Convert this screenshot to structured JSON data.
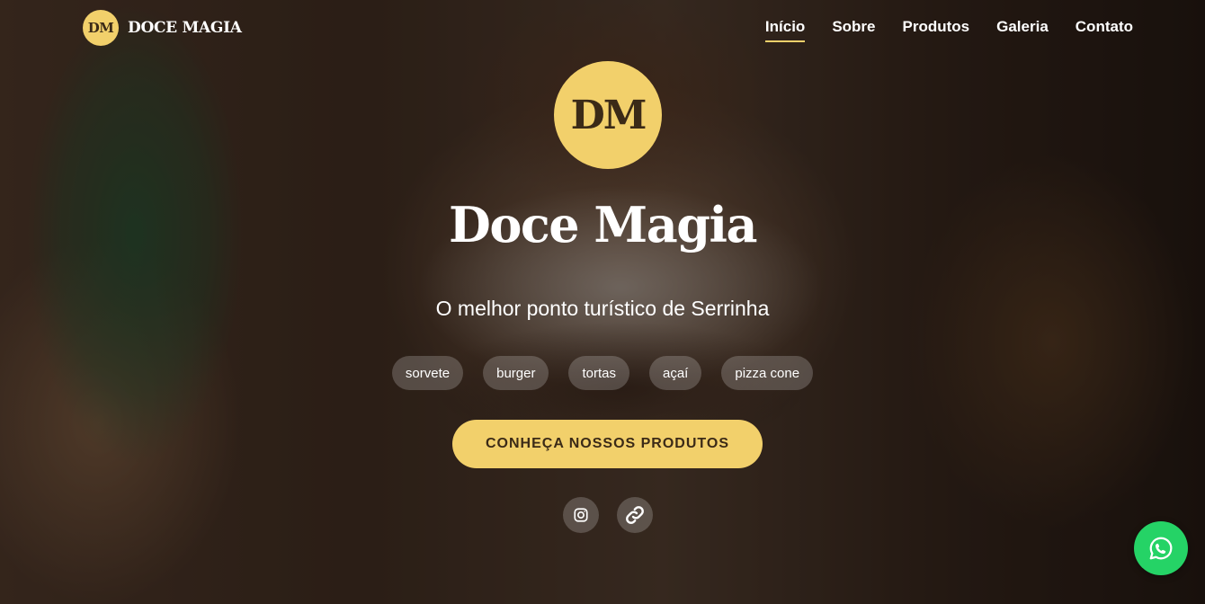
{
  "brand": {
    "initials": "DM",
    "name": "DOCE MAGIA"
  },
  "nav": {
    "items": [
      {
        "label": "Início",
        "active": true
      },
      {
        "label": "Sobre",
        "active": false
      },
      {
        "label": "Produtos",
        "active": false
      },
      {
        "label": "Galeria",
        "active": false
      },
      {
        "label": "Contato",
        "active": false
      }
    ]
  },
  "hero": {
    "logo_initials": "DM",
    "title": "Doce Magia",
    "subtitle": "O melhor ponto turístico de Serrinha",
    "tags": [
      "sorvete",
      "burger",
      "tortas",
      "açaí",
      "pizza cone"
    ],
    "cta_label": "CONHEÇA NOSSOS PRODUTOS",
    "socials": [
      {
        "icon": "instagram-icon"
      },
      {
        "icon": "link-icon"
      }
    ]
  },
  "whatsapp": {
    "icon": "whatsapp-icon"
  },
  "colors": {
    "accent": "#f2d06b",
    "accent_text": "#3b2a17",
    "whatsapp": "#25d366"
  }
}
